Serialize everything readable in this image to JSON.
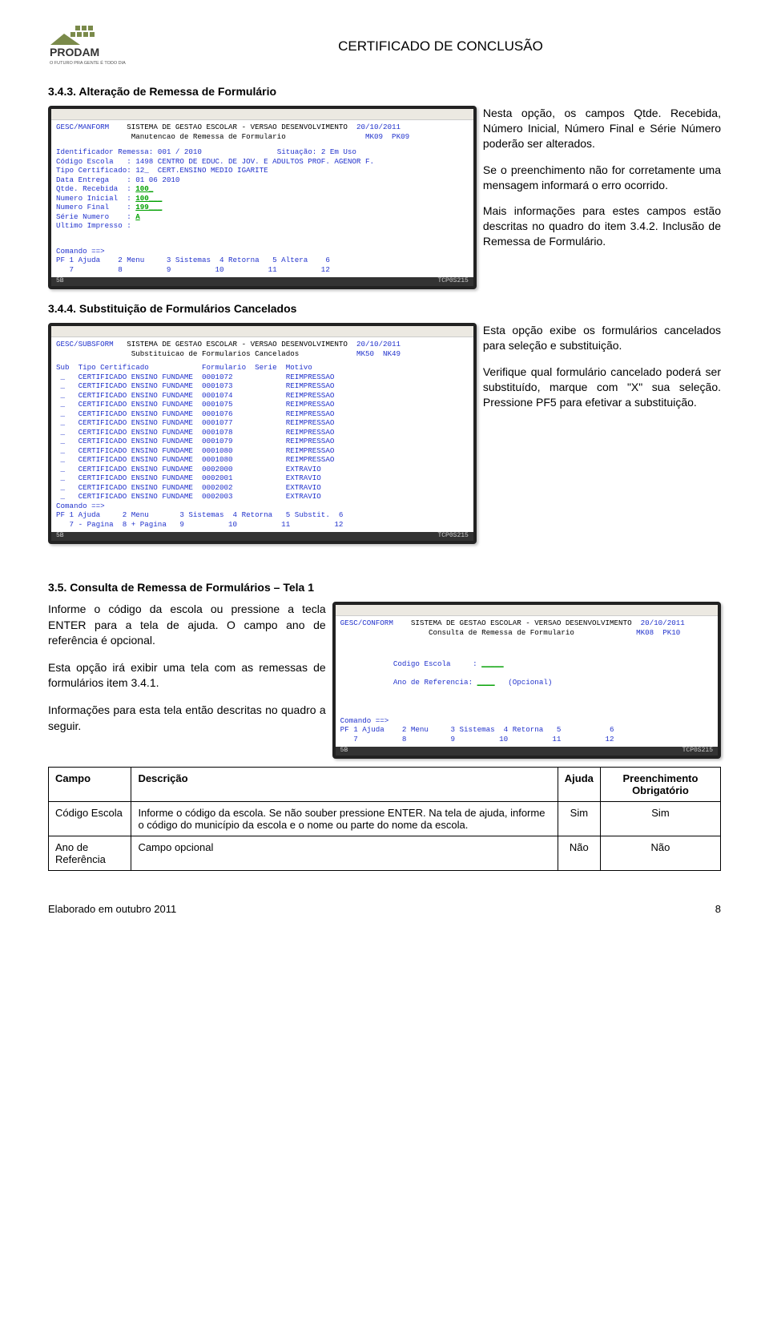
{
  "brand": {
    "tagline": "O FUTURO PRA GENTE É TODO DIA",
    "name": "PRODAM"
  },
  "doc": {
    "title": "CERTIFICADO DE CONCLUSÃO"
  },
  "sec343": {
    "heading": "3.4.3. Alteração de Remessa de Formulário",
    "p1": "Nesta opção, os campos Qtde. Recebida, Número Inicial, Número Final e Série Número poderão ser alterados.",
    "p2": "Se o preenchimento não for corretamente uma mensagem informará o erro ocorrido.",
    "p3": "Mais informações para estes campos estão descritas no quadro do item 3.4.2. Inclusão de Remessa de Formulário."
  },
  "shot1": {
    "program": "GESC/MANFORM",
    "title1": "SISTEMA DE GESTAO ESCOLAR - VERSAO DESENVOLVIMENTO",
    "title2": "Manutencao de Remessa de Formulario",
    "date": "20/10/2011",
    "codes": "MK09  PK09",
    "lines": {
      "l1a": "Identificador Remessa: 001 / 2010",
      "l1b": "Situação: 2 Em Uso",
      "l2": "Código Escola   : 1498 CENTRO DE EDUC. DE JOV. E ADULTOS PROF. AGENOR F.",
      "l3": "Tipo Certificado: 12_  CERT.ENSINO MEDIO IGARITE",
      "l4": "Data Entrega    : 01 06 2010",
      "l5": "Qtde. Recebida  :",
      "l5v": "100_",
      "l6": "Numero Inicial  :",
      "l6v": "100___",
      "l7": "Numero Final    :",
      "l7v": "199___",
      "l8": "Série Numero    :",
      "l8v": "A",
      "l9": "Ultimo Impresso :"
    },
    "cmd": "Comando ==>",
    "pf": "PF 1 Ajuda    2 Menu     3 Sistemas  4 Retorna   5 Altera    6\n   7          8          9          10          11          12",
    "status": "TCP0S215"
  },
  "sec344": {
    "heading": "3.4.4. Substituição de Formulários Cancelados",
    "p1": "Esta opção exibe os formulários cancelados para seleção e substituição.",
    "p2": "Verifique qual formulário cancelado poderá ser substituído, marque com \"X\" sua seleção. Pressione PF5 para efetivar a substituição."
  },
  "shot2": {
    "program": "GESC/SUBSFORM",
    "title1": "SISTEMA DE GESTAO ESCOLAR - VERSAO DESENVOLVIMENTO",
    "title2": "Substituicao de Formularios Cancelados",
    "date": "20/10/2011",
    "codes": "MK50  NK49",
    "head": "Sub  Tipo Certificado            Formulario  Serie  Motivo",
    "rows": [
      " _   CERTIFICADO ENSINO FUNDAME  0001072            REIMPRESSAO",
      " _   CERTIFICADO ENSINO FUNDAME  0001073            REIMPRESSAO",
      " _   CERTIFICADO ENSINO FUNDAME  0001074            REIMPRESSAO",
      " _   CERTIFICADO ENSINO FUNDAME  0001075            REIMPRESSAO",
      " _   CERTIFICADO ENSINO FUNDAME  0001076            REIMPRESSAO",
      " _   CERTIFICADO ENSINO FUNDAME  0001077            REIMPRESSAO",
      " _   CERTIFICADO ENSINO FUNDAME  0001078            REIMPRESSAO",
      " _   CERTIFICADO ENSINO FUNDAME  0001079            REIMPRESSAO",
      " _   CERTIFICADO ENSINO FUNDAME  0001080            REIMPRESSAO",
      " _   CERTIFICADO ENSINO FUNDAME  0001080            REIMPRESSAO",
      " _   CERTIFICADO ENSINO FUNDAME  0002000            EXTRAVIO",
      " _   CERTIFICADO ENSINO FUNDAME  0002001            EXTRAVIO",
      " _   CERTIFICADO ENSINO FUNDAME  0002002            EXTRAVIO",
      " _   CERTIFICADO ENSINO FUNDAME  0002003            EXTRAVIO"
    ],
    "cmd": "Comando ==>",
    "pf": "PF 1 Ajuda     2 Menu       3 Sistemas  4 Retorna   5 Substit.  6\n   7 - Pagina  8 + Pagina   9          10          11          12",
    "status": "TCP0S215"
  },
  "sec35": {
    "heading": "3.5. Consulta de Remessa de Formulários – Tela 1",
    "p1": "Informe o código da escola ou pressione a tecla ENTER para a tela de ajuda. O campo ano de referência é opcional.",
    "p2": "Esta opção irá exibir uma tela com as remessas de formulários item 3.4.1.",
    "p3": "Informações para esta tela então descritas no quadro a seguir."
  },
  "shot3": {
    "program": "GESC/CONFORM",
    "title1": "SISTEMA DE GESTAO ESCOLAR - VERSAO DESENVOLVIMENTO",
    "title2": "Consulta de Remessa de Formulario",
    "date": "20/10/2011",
    "codes": "MK08  PK10",
    "l1": "Codigo Escola     :",
    "l1v": "_____",
    "l2": "Ano de Referencia:",
    "l2v": "____",
    "l2opt": "(Opcional)",
    "cmd": "Comando ==>",
    "pf": "PF 1 Ajuda    2 Menu     3 Sistemas  4 Retorna   5           6\n   7          8          9          10          11          12",
    "status": "TCP0S215"
  },
  "table": {
    "h1": "Campo",
    "h2": "Descrição",
    "h3": "Ajuda",
    "h4": "Preenchimento Obrigatório",
    "rows": [
      {
        "c": "Código Escola",
        "d": "Informe o código da escola. Se não souber pressione ENTER. Na tela de ajuda, informe o código do município da escola e o nome ou parte do nome da escola.",
        "a": "Sim",
        "o": "Sim"
      },
      {
        "c": "Ano de Referência",
        "d": "Campo opcional",
        "a": "Não",
        "o": "Não"
      }
    ]
  },
  "footer": {
    "left": "Elaborado em outubro 2011",
    "page": "8"
  }
}
